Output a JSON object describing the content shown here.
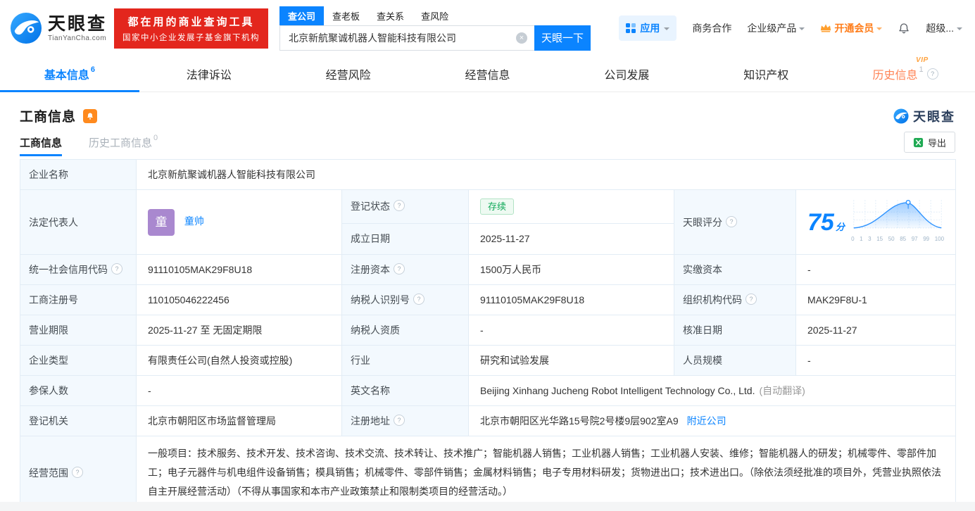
{
  "brand": {
    "name": "天眼查",
    "domain": "TianYanCha.com"
  },
  "header": {
    "promo_line1": "都在用的商业查询工具",
    "promo_line2": "国家中小企业发展子基金旗下机构",
    "search_tabs": [
      {
        "label": "查公司"
      },
      {
        "label": "查老板"
      },
      {
        "label": "查关系"
      },
      {
        "label": "查风险"
      }
    ],
    "search_value": "北京新航聚诚机器人智能科技有限公司",
    "search_button": "天眼一下",
    "menu_apps": "应用",
    "menu_cooperation": "商务合作",
    "menu_enterprise": "企业级产品",
    "menu_vip": "开通会员",
    "menu_super": "超级..."
  },
  "nav": {
    "tabs": [
      {
        "label": "基本信息",
        "count": "6"
      },
      {
        "label": "法律诉讼"
      },
      {
        "label": "经营风险"
      },
      {
        "label": "经营信息"
      },
      {
        "label": "公司发展"
      },
      {
        "label": "知识产权"
      },
      {
        "label": "历史信息",
        "count": "1",
        "vip": "VIP"
      }
    ]
  },
  "section": {
    "title": "工商信息",
    "watermark": "天眼查",
    "subtab_active": "工商信息",
    "subtab_history": "历史工商信息",
    "subtab_history_count": "0",
    "export_label": "导出"
  },
  "table": {
    "company_name": {
      "label": "企业名称",
      "value": "北京新航聚诚机器人智能科技有限公司"
    },
    "legal_rep": {
      "label": "法定代表人",
      "avatar": "童",
      "name": "童帅"
    },
    "reg_status": {
      "label": "登记状态",
      "value": "存续"
    },
    "establish_date": {
      "label": "成立日期",
      "value": "2025-11-27"
    },
    "score": {
      "label": "天眼评分",
      "value": "75",
      "unit": "分",
      "axis": [
        "0",
        "1",
        "3",
        "15",
        "50",
        "85",
        "97",
        "99",
        "100"
      ]
    },
    "credit_code": {
      "label": "统一社会信用代码",
      "value": "91110105MAK29F8U18"
    },
    "reg_capital": {
      "label": "注册资本",
      "value": "1500万人民币"
    },
    "paid_capital": {
      "label": "实缴资本",
      "value": "-"
    },
    "reg_number": {
      "label": "工商注册号",
      "value": "110105046222456"
    },
    "taxpayer_id": {
      "label": "纳税人识别号",
      "value": "91110105MAK29F8U18"
    },
    "org_code": {
      "label": "组织机构代码",
      "value": "MAK29F8U-1"
    },
    "business_term": {
      "label": "营业期限",
      "value": "2025-11-27 至 无固定期限"
    },
    "taxpayer_quality": {
      "label": "纳税人资质",
      "value": "-"
    },
    "approval_date": {
      "label": "核准日期",
      "value": "2025-11-27"
    },
    "company_type": {
      "label": "企业类型",
      "value": "有限责任公司(自然人投资或控股)"
    },
    "industry": {
      "label": "行业",
      "value": "研究和试验发展"
    },
    "staff_size": {
      "label": "人员规模",
      "value": "-"
    },
    "insured_count": {
      "label": "参保人数",
      "value": "-"
    },
    "english_name": {
      "label": "英文名称",
      "value": "Beijing Xinhang Jucheng Robot Intelligent Technology Co., Ltd.",
      "note": "(自动翻译)"
    },
    "reg_authority": {
      "label": "登记机关",
      "value": "北京市朝阳区市场监督管理局"
    },
    "reg_address": {
      "label": "注册地址",
      "value": "北京市朝阳区光华路15号院2号楼9层902室A9",
      "link": "附近公司"
    },
    "business_scope": {
      "label": "经营范围",
      "value": "一般项目：技术服务、技术开发、技术咨询、技术交流、技术转让、技术推广；智能机器人销售；工业机器人销售；工业机器人安装、维修；智能机器人的研发；机械零件、零部件加工；电子元器件与机电组件设备销售；模具销售；机械零件、零部件销售；金属材料销售；电子专用材料研发；货物进出口；技术进出口。（除依法须经批准的项目外，凭营业执照依法自主开展经营活动）（不得从事国家和本市产业政策禁止和限制类项目的经营活动。）"
    }
  },
  "colors": {
    "brand_blue": "#0b84ff",
    "promo_red": "#e3261d",
    "status_green": "#0fa958",
    "vip_orange": "#ff7d1a"
  }
}
